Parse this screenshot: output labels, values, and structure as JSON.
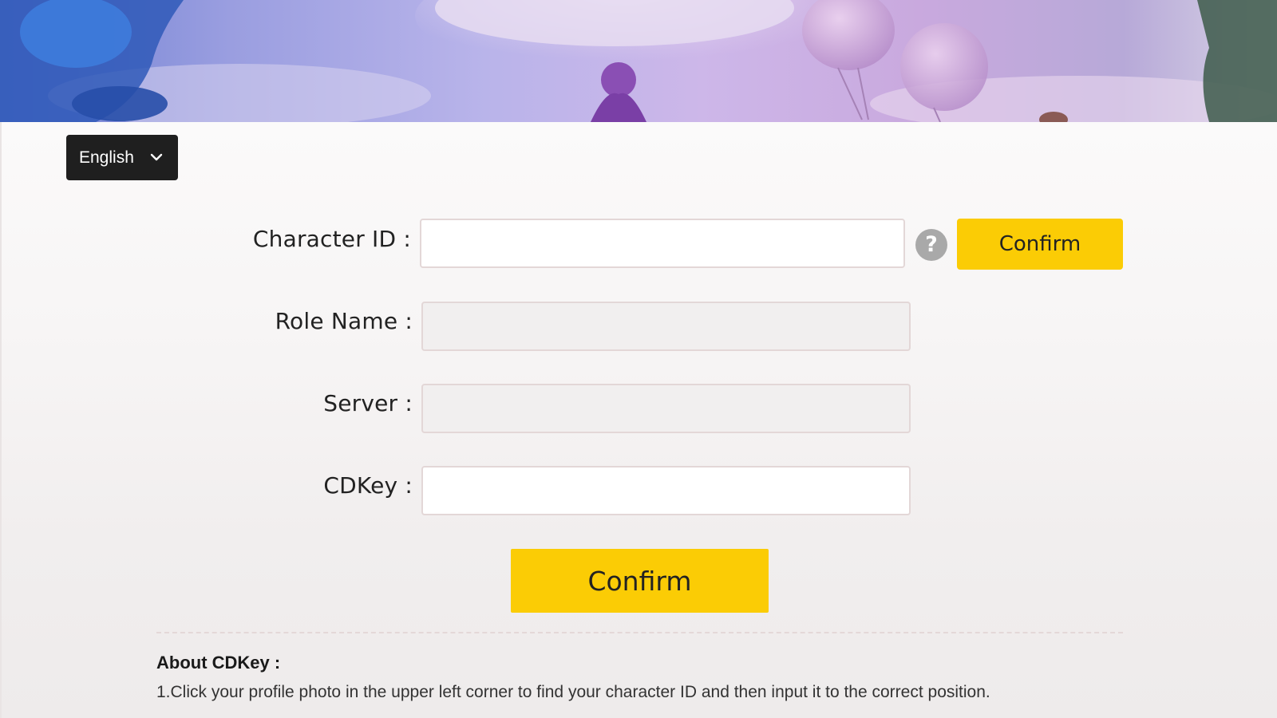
{
  "language": {
    "selected": "English",
    "icon": "chevron-down-icon"
  },
  "form": {
    "character_id": {
      "label": "Character ID :",
      "value": "",
      "help_icon": "question-mark-icon",
      "help_glyph": "?",
      "confirm_label": "Confirm"
    },
    "role_name": {
      "label": "Role Name :",
      "value": ""
    },
    "server": {
      "label": "Server :",
      "value": ""
    },
    "cdkey": {
      "label": "CDKey :",
      "value": ""
    },
    "submit_label": "Confirm"
  },
  "about": {
    "title": "About CDKey :",
    "items": [
      "1.Click your profile photo in the upper left corner to find your character ID and then input it to the correct position."
    ]
  },
  "colors": {
    "accent_yellow": "#fbcc05",
    "dark_select": "#1f1f1f",
    "help_icon_gray": "#a9a9a9",
    "readonly_field": "#f1efef"
  }
}
